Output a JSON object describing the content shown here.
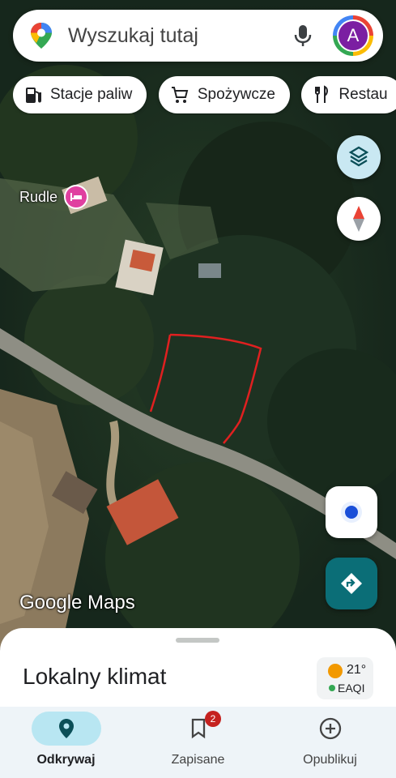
{
  "search": {
    "placeholder": "Wyszukaj tutaj",
    "avatar_letter": "A"
  },
  "chips": [
    {
      "label": "Stacje paliw",
      "icon": "gas-station-icon"
    },
    {
      "label": "Spożywcze",
      "icon": "cart-icon"
    },
    {
      "label": "Restau",
      "icon": "restaurant-icon"
    }
  ],
  "map": {
    "place_label": "Rudle",
    "place_icon": "hotel-icon",
    "watermark": "Google Maps"
  },
  "sheet": {
    "title": "Lokalny klimat",
    "temperature": "21°",
    "air_quality": "EAQI"
  },
  "nav": {
    "items": [
      {
        "label": "Odkrywaj",
        "icon": "explore-pin-icon",
        "active": true
      },
      {
        "label": "Zapisane",
        "icon": "bookmark-icon",
        "badge": "2"
      },
      {
        "label": "Opublikuj",
        "icon": "add-circle-icon"
      }
    ]
  },
  "colors": {
    "accent": "#0b6e77",
    "hotel_pin": "#e040a0",
    "boundary": "#e02020"
  }
}
